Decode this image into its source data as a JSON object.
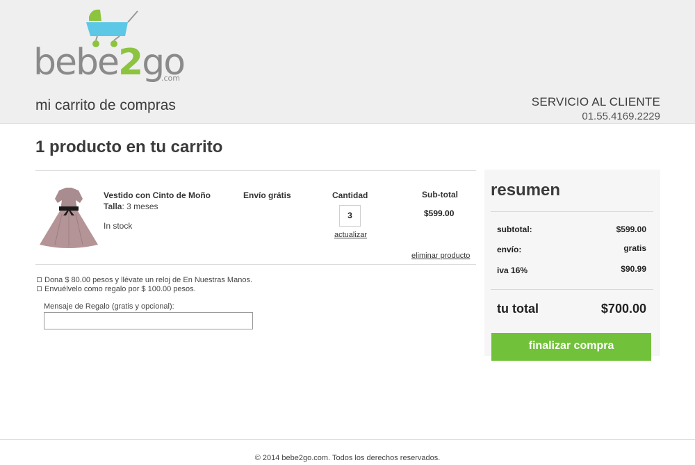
{
  "header": {
    "logo": {
      "word_prefix": "bebe",
      "word_accent": "2",
      "word_suffix": "go",
      "domain": ".com"
    },
    "page_heading": "mi carrito de compras",
    "service": {
      "title": "SERVICIO AL CLIENTE",
      "phone": "01.55.4169.2229"
    }
  },
  "cart": {
    "count_heading": "1 producto en tu carrito",
    "item": {
      "name": "Vestido con Cinto de Moño",
      "size_label": "Talla",
      "size_value": ": 3 meses",
      "stock": "In stock",
      "shipping": "Envío grátis",
      "quantity_label": "Cantidad",
      "quantity": "3",
      "update_link": "actualizar",
      "subtotal_label": "Sub-total",
      "subtotal": "$599.00",
      "remove_link": "eliminar producto"
    },
    "options": [
      {
        "label": "Dona $ 80.00 pesos y llévate un reloj de En Nuestras Manos.",
        "checked": false
      },
      {
        "label": "Envuélvelo como regalo por $ 100.00 pesos.",
        "checked": false
      }
    ],
    "gift_message_label": "Mensaje de Regalo (gratis y opcional):",
    "gift_message_value": ""
  },
  "summary": {
    "title": "resumen",
    "subtotal_label": "subtotal:",
    "subtotal": "$599.00",
    "shipping_label": "envío:",
    "shipping": "gratis",
    "tax_label": "iva 16%",
    "tax": "$90.99",
    "total_label": "tu total",
    "total": "$700.00",
    "checkout_button": "finalizar compra"
  },
  "footer": {
    "copyright": "© 2014 bebe2go.com. Todos los derechos reservados."
  },
  "colors": {
    "accent_green": "#72c13a",
    "logo_green": "#8cc43f",
    "stroller_blue": "#5cc8e6",
    "header_bg": "#efefef"
  }
}
